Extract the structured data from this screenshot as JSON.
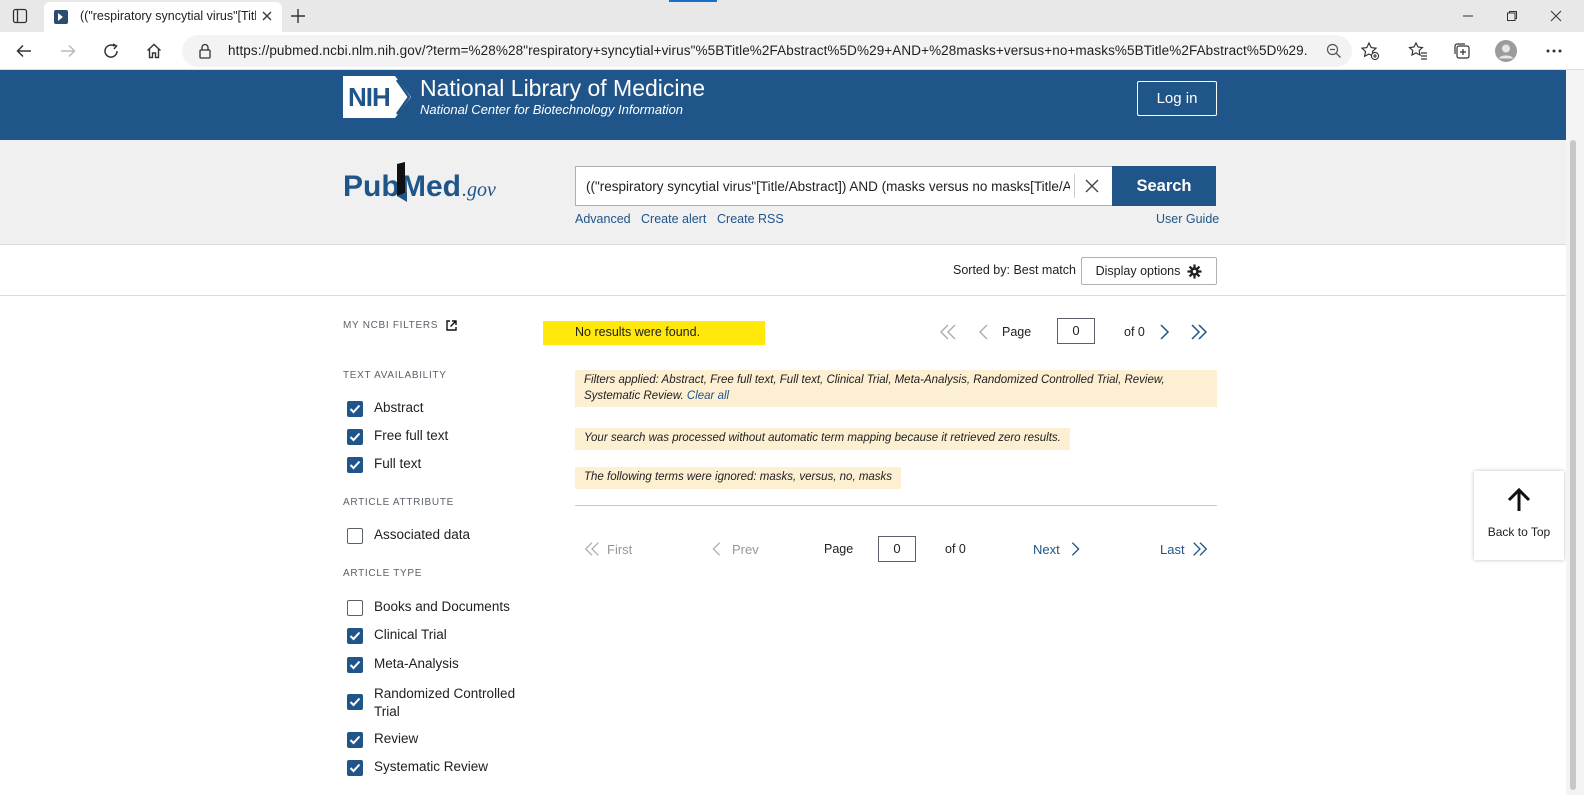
{
  "browser": {
    "tab_title": "((\"respiratory syncytial virus\"[Title/Abstract]) AND (masks versus no masks[Title/Abstract]))",
    "url": "https://pubmed.ncbi.nlm.nih.gov/?term=%28%28\"respiratory+syncytial+virus\"%5BTitle%2FAbstract%5D%29+AND+%28masks+versus+no+masks%5BTitle%2FAbstract%5D%29..."
  },
  "header": {
    "nih_mark": "NIH",
    "title": "National Library of Medicine",
    "subtitle": "National Center for Biotechnology Information",
    "login_label": "Log in"
  },
  "search": {
    "logo_pub": "Pub",
    "logo_med": "Med",
    "logo_gov": ".gov",
    "query": "((\"respiratory syncytial virus\"[Title/Abstract]) AND (masks versus no masks[Title/Abstract]))",
    "button_label": "Search",
    "links": [
      "Advanced",
      "Create alert",
      "Create RSS"
    ],
    "user_guide": "User Guide"
  },
  "sort": {
    "sorted_by": "Sorted by: Best match",
    "display_options": "Display options"
  },
  "filters": {
    "my_ncbi": "MY NCBI FILTERS",
    "text_availability": {
      "heading": "TEXT AVAILABILITY",
      "items": [
        {
          "label": "Abstract",
          "checked": true
        },
        {
          "label": "Free full text",
          "checked": true
        },
        {
          "label": "Full text",
          "checked": true
        }
      ]
    },
    "article_attribute": {
      "heading": "ARTICLE ATTRIBUTE",
      "items": [
        {
          "label": "Associated data",
          "checked": false
        }
      ]
    },
    "article_type": {
      "heading": "ARTICLE TYPE",
      "items": [
        {
          "label": "Books and Documents",
          "checked": false
        },
        {
          "label": "Clinical Trial",
          "checked": true
        },
        {
          "label": "Meta-Analysis",
          "checked": true
        },
        {
          "label": "Randomized Controlled Trial",
          "checked": true
        },
        {
          "label": "Review",
          "checked": true
        },
        {
          "label": "Systematic Review",
          "checked": true
        }
      ]
    }
  },
  "results": {
    "no_results": "No results were found.",
    "page_label": "Page",
    "page_value": "0",
    "of_label": "of 0",
    "filters_applied": "Filters applied: Abstract, Free full text, Full text, Clinical Trial, Meta-Analysis, Randomized Controlled Trial, Review, Systematic Review.",
    "clear_all": "Clear all",
    "processed_msg": "Your search was processed without automatic term mapping because it retrieved zero results.",
    "ignored_msg": "The following terms were ignored: masks, versus, no, masks",
    "first": "First",
    "prev": "Prev",
    "next": "Next",
    "last": "Last"
  },
  "back_to_top": "Back to Top",
  "colors": {
    "brand_blue": "#20558a",
    "highlight_yellow": "#ffe80a",
    "notice_bg": "#fdefd1"
  }
}
